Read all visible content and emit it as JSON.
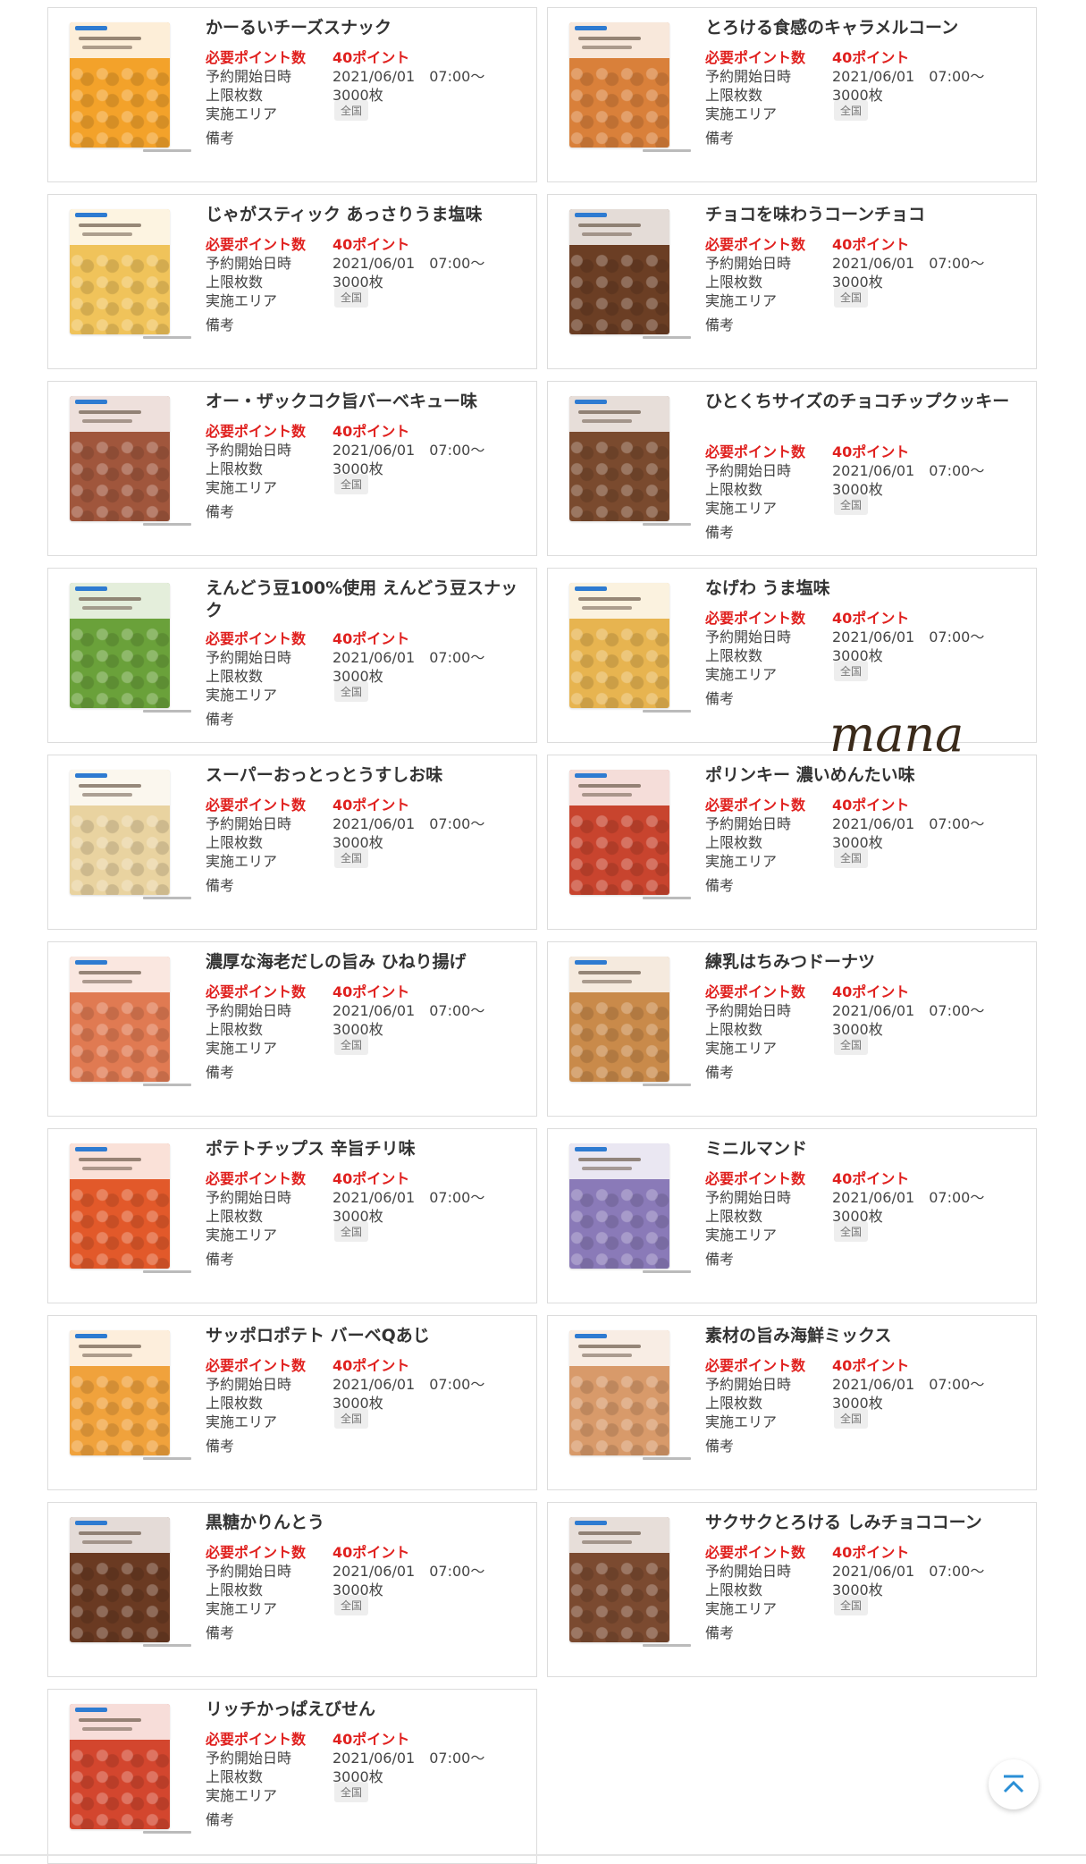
{
  "labels": {
    "required_points": "必要ポイント数",
    "start_datetime": "予約開始日時",
    "limit_count": "上限枚数",
    "area": "実施エリア",
    "remarks": "備考"
  },
  "signature": "mana",
  "colors": {
    "accent_red": "#e0201e",
    "scroll_icon": "#2a8fd6"
  },
  "items": [
    {
      "title": "かーるいチーズスナック",
      "points": "40ポイント",
      "start": "2021/06/01　07:00〜",
      "limit": "3000枚",
      "area": "全国",
      "color": "#f3a22a",
      "icon": "cheese-snack-package-image"
    },
    {
      "title": "とろける食感のキャラメルコーン",
      "points": "40ポイント",
      "start": "2021/06/01　07:00〜",
      "limit": "3000枚",
      "area": "全国",
      "color": "#d9803a",
      "icon": "caramel-corn-package-image"
    },
    {
      "title": "じゃがスティック あっさりうま塩味",
      "points": "40ポイント",
      "start": "2021/06/01　07:00〜",
      "limit": "3000枚",
      "area": "全国",
      "color": "#f0c35a",
      "icon": "potato-stick-package-image"
    },
    {
      "title": "チョコを味わうコーンチョコ",
      "points": "40ポイント",
      "start": "2021/06/01　07:00〜",
      "limit": "3000枚",
      "area": "全国",
      "color": "#6b3e24",
      "icon": "corn-choco-package-image"
    },
    {
      "title": "オー・ザックコク旨バーベキュー味",
      "points": "40ポイント",
      "start": "2021/06/01　07:00〜",
      "limit": "3000枚",
      "area": "全国",
      "color": "#a0563c",
      "icon": "ozack-bbq-package-image"
    },
    {
      "title": "ひとくちサイズのチョコチップクッキー",
      "points": "40ポイント",
      "start": "2021/06/01　07:00〜",
      "limit": "3000枚",
      "area": "全国",
      "color": "#7a4a2e",
      "icon": "chocochip-cookie-package-image"
    },
    {
      "title": "えんどう豆100%使用 えんどう豆スナック",
      "points": "40ポイント",
      "start": "2021/06/01　07:00〜",
      "limit": "3000枚",
      "area": "全国",
      "color": "#6aa13a",
      "icon": "pea-snack-package-image"
    },
    {
      "title": "なげわ うま塩味",
      "points": "40ポイント",
      "start": "2021/06/01　07:00〜",
      "limit": "3000枚",
      "area": "全国",
      "color": "#e7b450",
      "icon": "nagewa-package-image"
    },
    {
      "title": "スーパーおっとっとうすしお味",
      "points": "40ポイント",
      "start": "2021/06/01　07:00〜",
      "limit": "3000枚",
      "area": "全国",
      "color": "#e9d3a0",
      "icon": "ottotto-package-image"
    },
    {
      "title": "ポリンキー 濃いめんたい味",
      "points": "40ポイント",
      "start": "2021/06/01　07:00〜",
      "limit": "3000枚",
      "area": "全国",
      "color": "#c8442e",
      "icon": "polinky-package-image"
    },
    {
      "title": "濃厚な海老だしの旨み ひねり揚げ",
      "points": "40ポイント",
      "start": "2021/06/01　07:00〜",
      "limit": "3000枚",
      "area": "全国",
      "color": "#e07a52",
      "icon": "hineri-age-package-image"
    },
    {
      "title": "練乳はちみつドーナツ",
      "points": "40ポイント",
      "start": "2021/06/01　07:00〜",
      "limit": "3000枚",
      "area": "全国",
      "color": "#c98a4a",
      "icon": "donut-package-image"
    },
    {
      "title": "ポテトチップス 辛旨チリ味",
      "points": "40ポイント",
      "start": "2021/06/01　07:00〜",
      "limit": "3000枚",
      "area": "全国",
      "color": "#e2592a",
      "icon": "chili-chips-package-image"
    },
    {
      "title": "ミニルマンド",
      "points": "40ポイント",
      "start": "2021/06/01　07:00〜",
      "limit": "3000枚",
      "area": "全国",
      "color": "#8a7ab8",
      "icon": "mini-lumonde-package-image"
    },
    {
      "title": "サッポロポテト バーベQあじ",
      "points": "40ポイント",
      "start": "2021/06/01　07:00〜",
      "limit": "3000枚",
      "area": "全国",
      "color": "#f0a23c",
      "icon": "sapporo-potato-package-image"
    },
    {
      "title": "素材の旨み海鮮ミックス",
      "points": "40ポイント",
      "start": "2021/06/01　07:00〜",
      "limit": "3000枚",
      "area": "全国",
      "color": "#d89a6a",
      "icon": "seafood-mix-package-image"
    },
    {
      "title": "黒糖かりんとう",
      "points": "40ポイント",
      "start": "2021/06/01　07:00〜",
      "limit": "3000枚",
      "area": "全国",
      "color": "#6a3a22",
      "icon": "karinto-package-image"
    },
    {
      "title": "サクサクとろける しみチョココーン",
      "points": "40ポイント",
      "start": "2021/06/01　07:00〜",
      "limit": "3000枚",
      "area": "全国",
      "color": "#7b4a30",
      "icon": "shimi-choco-corn-package-image"
    },
    {
      "title": "リッチかっぱえびせん",
      "points": "40ポイント",
      "start": "2021/06/01　07:00〜",
      "limit": "3000枚",
      "area": "全国",
      "color": "#d3462e",
      "icon": "kappa-ebisen-package-image"
    }
  ]
}
